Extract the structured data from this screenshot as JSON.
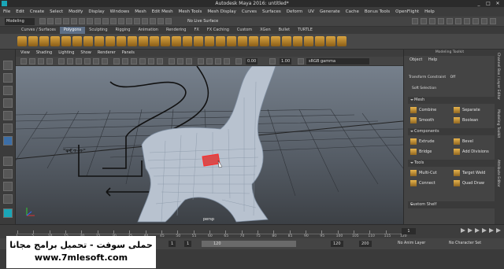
{
  "window": {
    "title": "Autodesk Maya 2016: untitled*",
    "controls": [
      "_",
      "□",
      "✕"
    ]
  },
  "menubar": {
    "items": [
      "File",
      "Edit",
      "Create",
      "Select",
      "Modify",
      "Display",
      "Windows",
      "Mesh",
      "Edit Mesh",
      "Mesh Tools",
      "Mesh Display",
      "Curves",
      "Surfaces",
      "Deform",
      "UV",
      "Generate",
      "Cache",
      "Bonus Tools",
      "OpenFlight",
      "Help"
    ]
  },
  "statusline": {
    "mode": "Modeling",
    "live_surface": "No Live Surface"
  },
  "shelf": {
    "tabs": [
      "Curves / Surfaces",
      "Polygons",
      "Sculpting",
      "Rigging",
      "Animation",
      "Rendering",
      "FX",
      "FX Caching",
      "Custom",
      "XGen",
      "Bullet",
      "TURTLE"
    ],
    "active_tab": "Polygons"
  },
  "viewport": {
    "menus": [
      "View",
      "Shading",
      "Lighting",
      "Show",
      "Renderer",
      "Panels"
    ],
    "value_a": "0.00",
    "value_b": "1.00",
    "color_space": "sRGB gamma",
    "camera": "persp"
  },
  "modeling_toolkit": {
    "header": "Modeling Toolkit",
    "menus": [
      "Object",
      "Help"
    ],
    "constraint_label": "Transform Constraint",
    "constraint_value": "Off",
    "soft_selection": "Soft Selection",
    "sections": {
      "mesh": "Mesh",
      "components": "Components",
      "tools": "Tools"
    },
    "mesh_buttons": [
      "Combine",
      "Separate",
      "Smooth",
      "Boolean"
    ],
    "component_buttons": [
      "Extrude",
      "Bevel",
      "Bridge",
      "Add Divisions"
    ],
    "tool_buttons": [
      "Multi-Cut",
      "Target Weld",
      "Connect",
      "Quad Draw"
    ],
    "custom_shelf": "Custom Shelf",
    "side_tabs": [
      "Channel Box / Layer Editor",
      "Modeling Toolkit",
      "Attribute Editor"
    ]
  },
  "timeslider": {
    "current_frame": "1",
    "tick_labels": [
      "1",
      "5",
      "10",
      "15",
      "20",
      "25",
      "30",
      "35",
      "40",
      "45",
      "50",
      "55",
      "60",
      "65",
      "70",
      "75",
      "80",
      "85",
      "90",
      "95",
      "100",
      "105",
      "110",
      "115",
      "120"
    ]
  },
  "range": {
    "start": "1",
    "start_inner": "1",
    "end_inner": "120",
    "end": "120",
    "end_max": "200",
    "anim_layer": "No Anim Layer",
    "character_set": "No Character Set"
  },
  "watermark": {
    "line1": "حملى سوفت - تحميل برامج مجانا",
    "line2": "www.7mlesoft.com"
  }
}
